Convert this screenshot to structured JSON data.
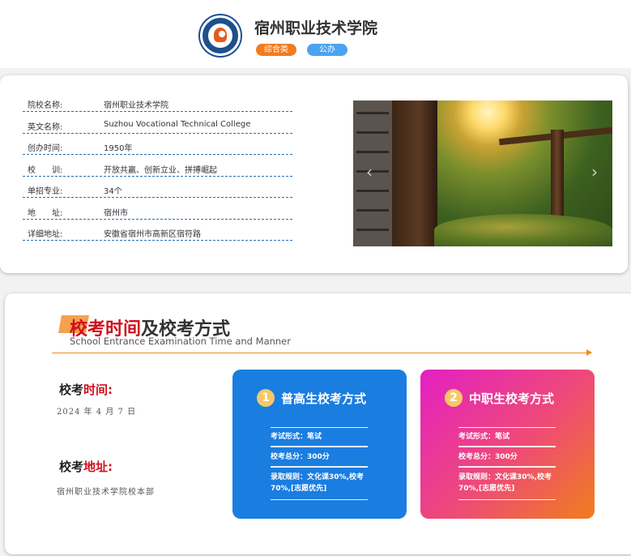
{
  "header": {
    "title": "宿州职业技术学院",
    "tags": [
      "综合类",
      "公办"
    ]
  },
  "info": {
    "rows": [
      {
        "label": "院校名称:",
        "value": "宿州职业技术学院"
      },
      {
        "label": "英文名称:",
        "value": "Suzhou Vocational Technical College"
      },
      {
        "label": "创办时间:",
        "value": "1950年"
      },
      {
        "label": "校　　训:",
        "value": "开放共赢、创新立业、拼搏崛起"
      },
      {
        "label": "单招专业:",
        "value": "34个"
      },
      {
        "label": "地　　址:",
        "value": "宿州市"
      },
      {
        "label": "详细地址:",
        "value": "安徽省宿州市高新区宿符路"
      }
    ],
    "carousel": {
      "prev_icon": "chevron-left-icon",
      "next_icon": "chevron-right-icon"
    }
  },
  "exam": {
    "section_title_red": "校考时间",
    "section_title_rest": "及校考方式",
    "section_subtitle": "School Entrance Examination Time and Manner",
    "time_label_a": "校考",
    "time_label_b": "时间:",
    "time_value": "2024 年 4 月 7 日",
    "place_label_a": "校考",
    "place_label_b": "地址:",
    "place_value": "宿州职业技术学院校本部",
    "modes": [
      {
        "number": "1",
        "title": "普高生校考方式",
        "form": "考试形式：笔试",
        "total": "校考总分：300分",
        "rule": "录取规则：文化课30%,校考70%,[志愿优先]"
      },
      {
        "number": "2",
        "title": "中职生校考方式",
        "form": "考试形式：笔试",
        "total": "校考总分：300分",
        "rule": "录取规则：文化课30%,校考70%,[志愿优先]"
      }
    ]
  },
  "colors": {
    "accent_red": "#d0101d",
    "accent_orange": "#f08c1e",
    "tag_orange": "#f27b1f",
    "tag_blue": "#4aa3f0",
    "card_blue": "#1a7de0",
    "card_gradient_start": "#e41fc4",
    "card_gradient_end": "#f07e1c"
  }
}
